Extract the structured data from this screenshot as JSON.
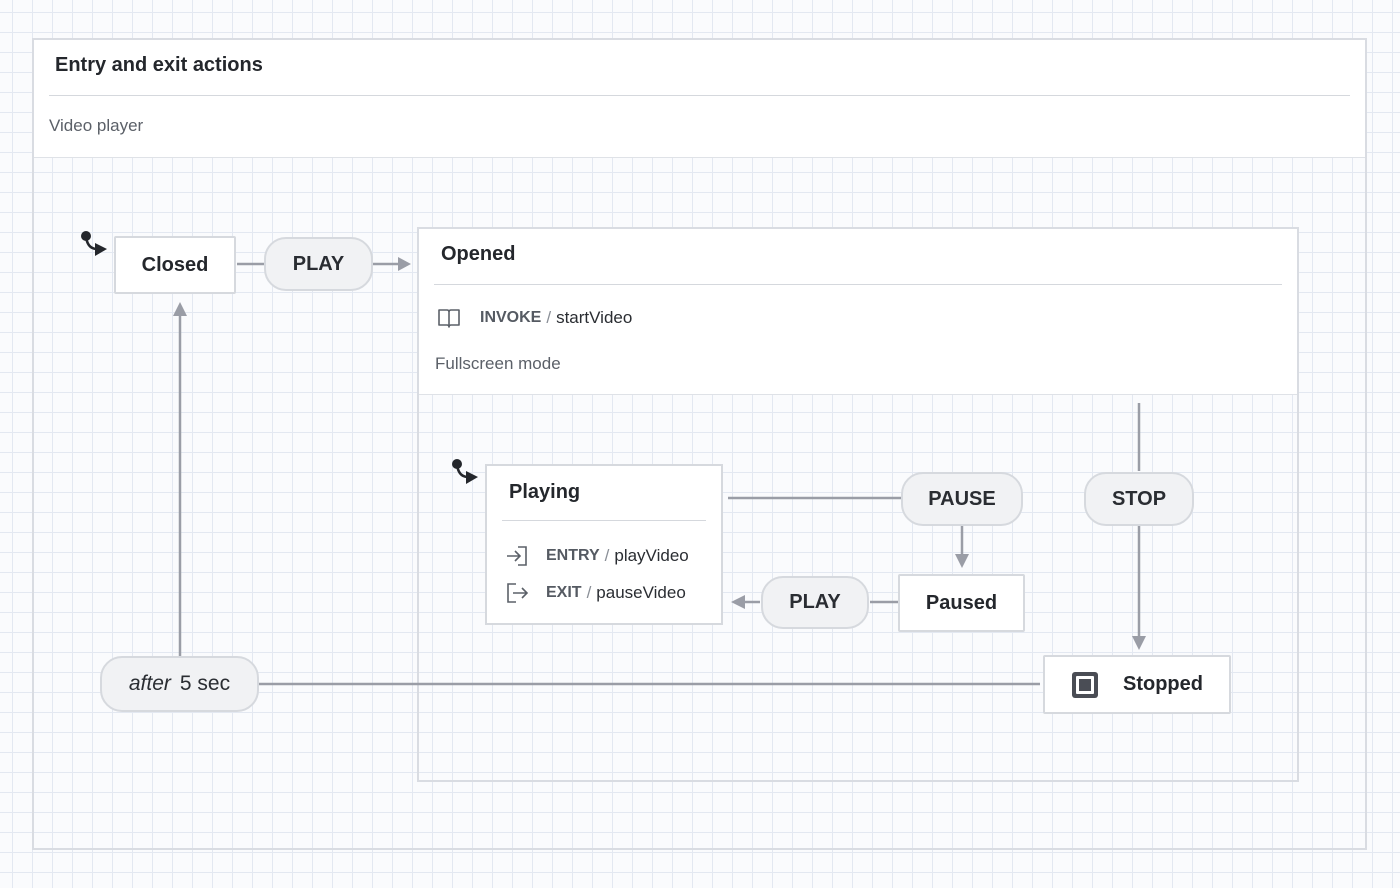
{
  "machine": {
    "title": "Entry and exit actions",
    "description": "Video player"
  },
  "states": {
    "closed": {
      "label": "Closed"
    },
    "opened": {
      "label": "Opened",
      "invoke_keyword": "INVOKE",
      "separator": "/",
      "invoke_action": "startVideo",
      "description": "Fullscreen mode"
    },
    "playing": {
      "label": "Playing",
      "entry_keyword": "ENTRY",
      "entry_action": "playVideo",
      "exit_keyword": "EXIT",
      "exit_action": "pauseVideo",
      "separator": "/"
    },
    "paused": {
      "label": "Paused"
    },
    "stopped": {
      "label": "Stopped"
    }
  },
  "events": {
    "play_open": "PLAY",
    "pause": "PAUSE",
    "play_resume": "PLAY",
    "stop": "STOP",
    "after_keyword": "after",
    "after_value": "5 sec"
  },
  "icons": {
    "initial_state": "initial-state-icon",
    "invoke": "book-icon",
    "entry": "entry-icon",
    "exit": "exit-icon",
    "final_state": "final-state-icon"
  },
  "colors": {
    "edge": "#9a9da6",
    "node_border": "#d6d9de",
    "pill_bg": "#f1f2f4",
    "grid": "#e3e8f1"
  }
}
